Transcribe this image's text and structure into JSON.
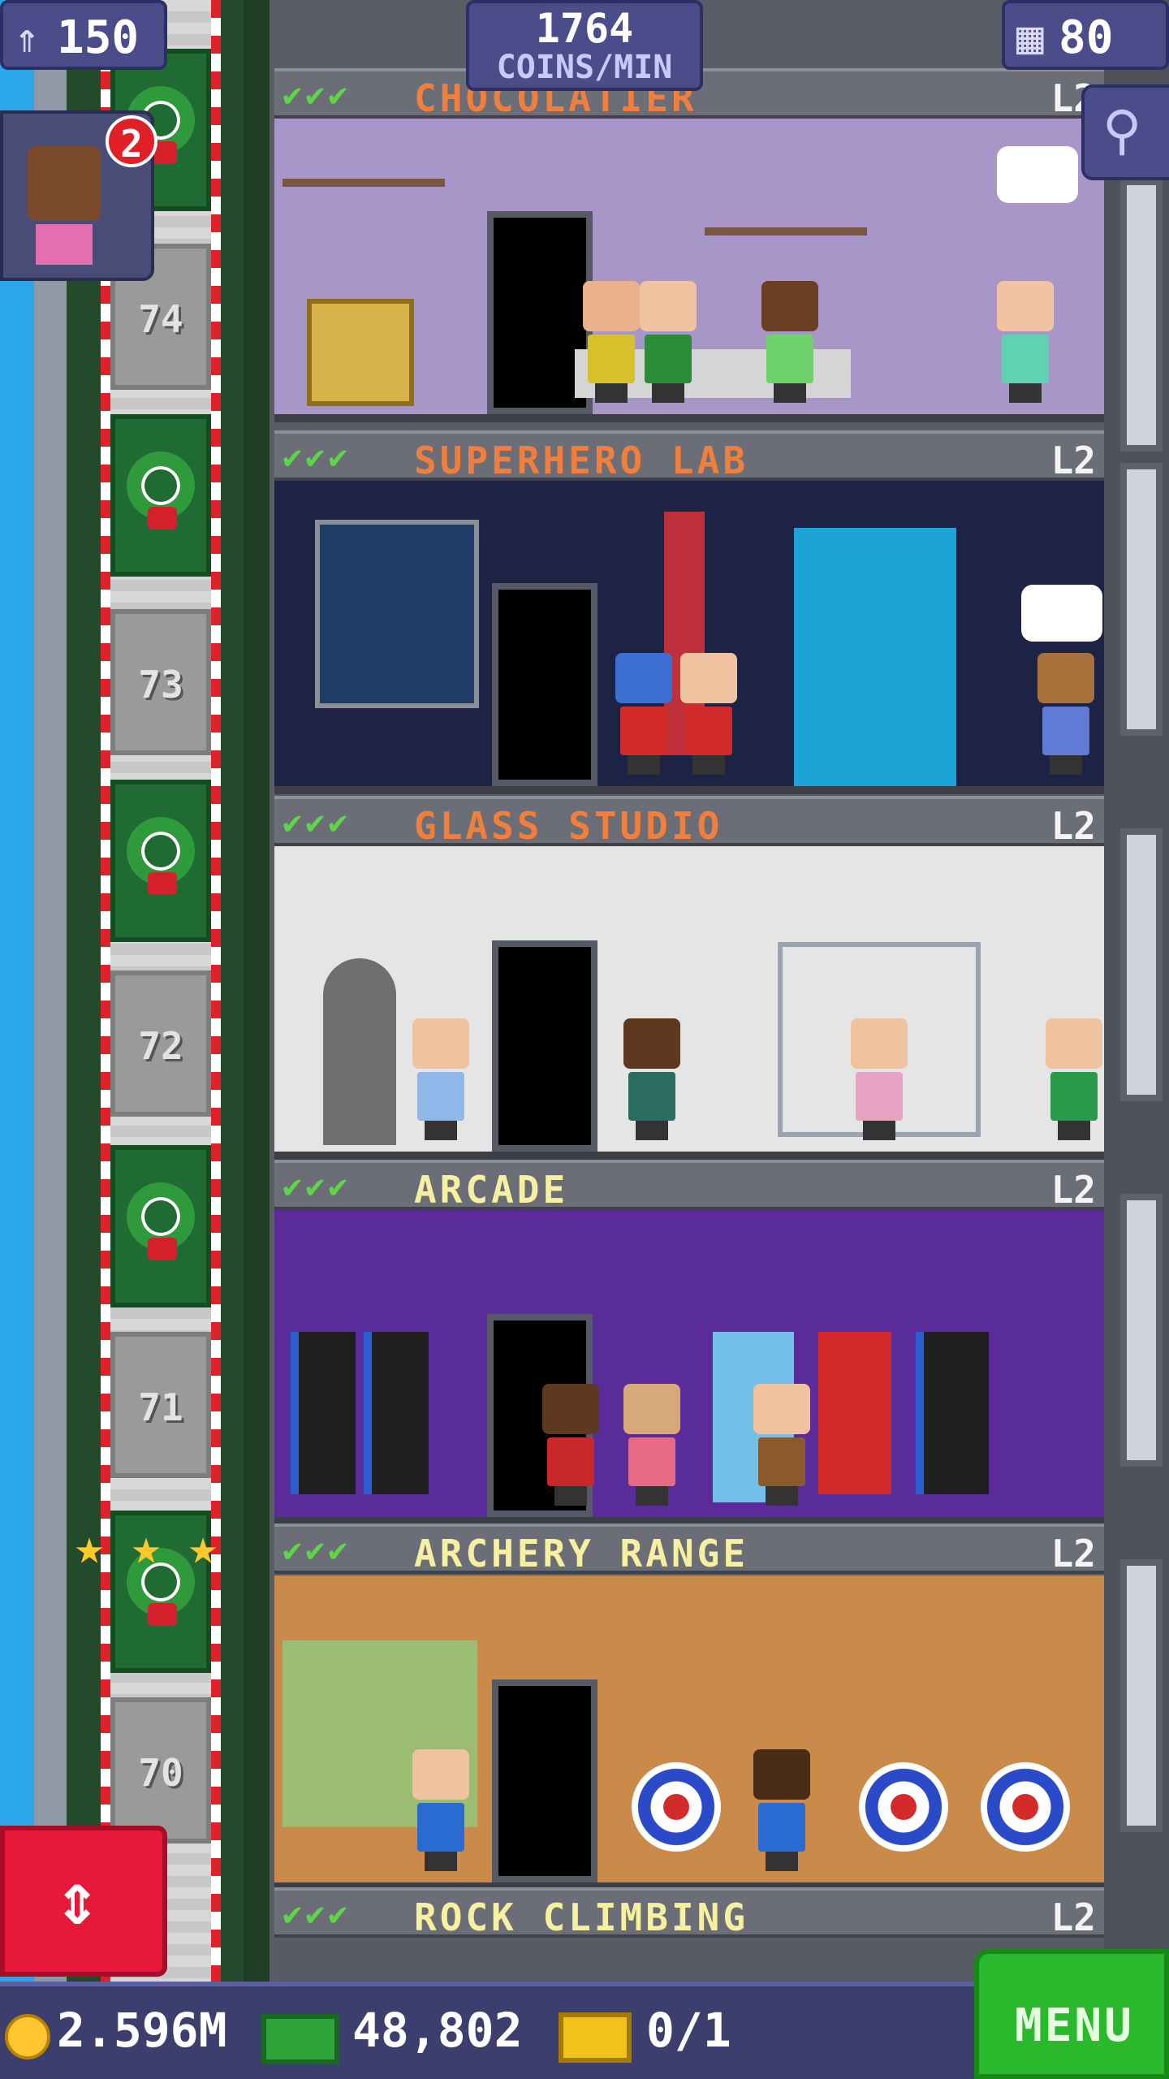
{
  "hud": {
    "population": "150",
    "coins_per_min_value": "1764",
    "coins_per_min_unit": "COINS/MIN",
    "floors": "80",
    "visitor_badge": "2"
  },
  "floors": [
    {
      "name": "CHOCOLATIER",
      "level": "L2",
      "name_color": "#f07e3c"
    },
    {
      "name": "SUPERHERO LAB",
      "level": "L2",
      "name_color": "#f07e3c"
    },
    {
      "name": "GLASS STUDIO",
      "level": "L2",
      "name_color": "#f07e3c"
    },
    {
      "name": "ARCADE",
      "level": "L2",
      "name_color": "#f6f0a0"
    },
    {
      "name": "ARCHERY RANGE",
      "level": "L2",
      "name_color": "#f6f0a0"
    },
    {
      "name": "ROCK CLIMBING",
      "level": "L2",
      "name_color": "#f6f0a0"
    }
  ],
  "elevator_floors": [
    "74",
    "73",
    "72",
    "71",
    "70"
  ],
  "checks": "✔✔✔",
  "bottom": {
    "coins": "2.596M",
    "bux": "48,802",
    "tickets": "0/1",
    "menu": "MENU"
  },
  "icons": {
    "population": "person-up-icon",
    "floors": "building-icon",
    "zoom": "magnifier-icon",
    "elevator": "up-down-arrows-icon",
    "coin": "coin-icon",
    "bux": "tower-bux-icon",
    "ticket": "golden-ticket-icon"
  }
}
